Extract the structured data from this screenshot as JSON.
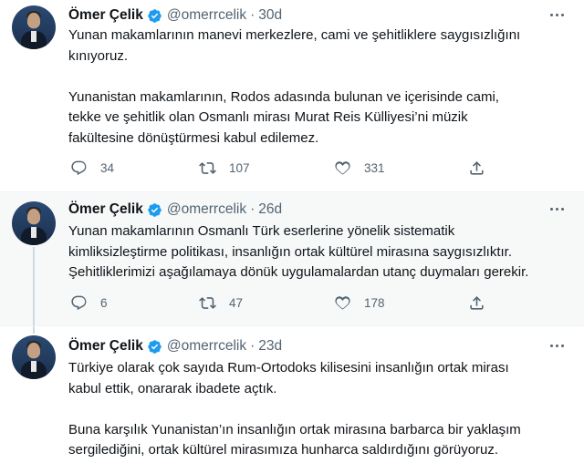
{
  "tweets": [
    {
      "name": "Ömer Çelik",
      "handle": "@omerrcelik",
      "separator": "·",
      "time": "30d",
      "lines": [
        "Yunan makamlarının manevi merkezlere, cami ve şehitliklere saygısızlığını",
        "kınıyoruz.",
        "",
        "Yunanistan makamlarının, Rodos adasında bulunan ve içerisinde cami,",
        "tekke ve şehitlik olan Osmanlı mirası Murat Reis Külliyesi’ni müzik",
        "fakültesine dönüştürmesi kabul edilemez."
      ],
      "replies": "34",
      "retweets": "107",
      "likes": "331"
    },
    {
      "name": "Ömer Çelik",
      "handle": "@omerrcelik",
      "separator": "·",
      "time": "26d",
      "lines": [
        "Yunan makamlarının Osmanlı Türk eserlerine yönelik sistematik",
        "kimliksizleştirme politikası, insanlığın ortak kültürel mirasına saygısızlıktır.",
        "Şehitliklerimizi aşağılamaya dönük uygulamalardan utanç duymaları gerekir."
      ],
      "replies": "6",
      "retweets": "47",
      "likes": "178"
    },
    {
      "name": "Ömer Çelik",
      "handle": "@omerrcelik",
      "separator": "·",
      "time": "23d",
      "lines": [
        "Türkiye olarak çok sayıda Rum-Ortodoks kilisesini insanlığın ortak mirası",
        "kabul ettik, onararak ibadete açtık.",
        "",
        "Buna karşılık Yunanistan’ın insanlığın ortak mirasına barbarca bir yaklaşım",
        "sergilediğini, ortak kültürel mirasımıza hunharca saldırdığını görüyoruz."
      ]
    }
  ],
  "colors": {
    "verified": "#1d9bf0",
    "muted": "#536471",
    "thread_line": "#cfd9de"
  },
  "icons": [
    "reply-icon",
    "retweet-icon",
    "like-icon",
    "share-icon",
    "verified-badge-icon",
    "more-icon"
  ]
}
